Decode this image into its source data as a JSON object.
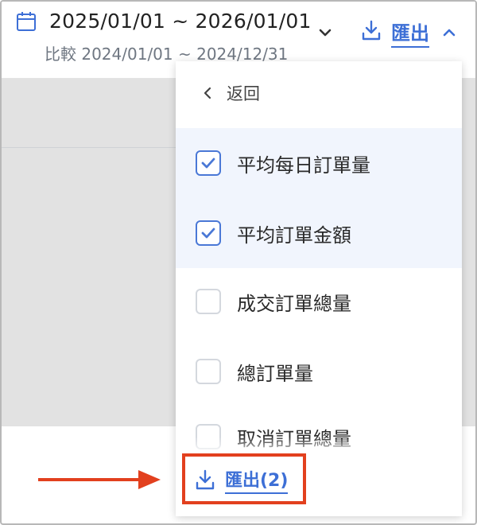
{
  "header": {
    "date_range": "2025/01/01 ~ 2026/01/01",
    "compare_label": "比較 2024/01/01 ~ 2024/12/31",
    "export_label": "匯出"
  },
  "dropdown": {
    "back_label": "返回",
    "options": [
      {
        "label": "平均每日訂單量",
        "checked": true
      },
      {
        "label": "平均訂單金額",
        "checked": true
      },
      {
        "label": "成交訂單總量",
        "checked": false
      },
      {
        "label": "總訂單量",
        "checked": false
      },
      {
        "label": "取消訂單總量",
        "checked": false
      }
    ],
    "export_button_label": "匯出(2)"
  },
  "colors": {
    "accent": "#3d6fd6",
    "highlight": "#e2401e",
    "checked_bg": "#f1f5fd"
  },
  "icons": [
    "calendar-icon",
    "chevron-down-icon",
    "download-icon",
    "chevron-up-icon",
    "chevron-left-icon",
    "check-icon",
    "arrow-right-icon"
  ]
}
